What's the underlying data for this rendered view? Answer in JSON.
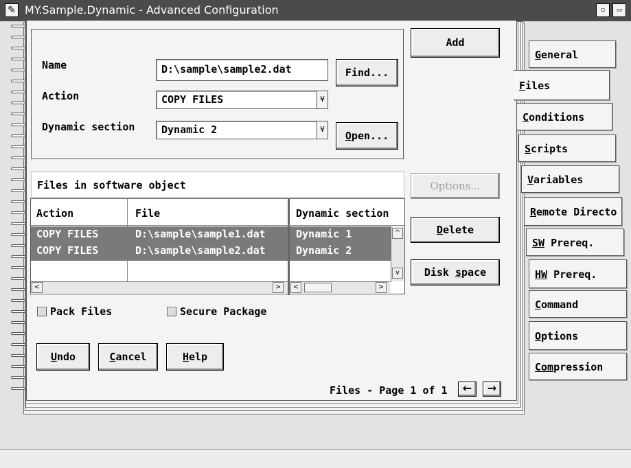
{
  "window": {
    "title": "MY.Sample.Dynamic - Advanced Configuration",
    "icon": "checkbox-pen-icon",
    "min_glyph": "▫",
    "max_glyph": "▭"
  },
  "form": {
    "name_label": "Name",
    "name_value": "D:\\sample\\sample2.dat",
    "find_button": "Find...",
    "action_label": "Action",
    "action_value": "COPY FILES",
    "dynamic_label": "Dynamic section",
    "dynamic_value": "Dynamic 2",
    "open_button_pre": "",
    "open_button_key": "O",
    "open_button_post": "pen...",
    "combo_arrow_glyph": "¥"
  },
  "buttons": {
    "add": "Add",
    "options": "Options...",
    "delete_key": "D",
    "delete_post": "elete",
    "disk_pre": "Disk ",
    "disk_key": "s",
    "disk_post": "pace",
    "undo_key": "U",
    "undo_post": "ndo",
    "cancel_key": "C",
    "cancel_post": "ancel",
    "help_key": "H",
    "help_post": "elp"
  },
  "list": {
    "title": "Files in software object",
    "columns": [
      "Action",
      "File",
      "Dynamic section"
    ],
    "rows": [
      {
        "action": "COPY FILES",
        "file": "D:\\sample\\sample1.dat",
        "section": "Dynamic 1"
      },
      {
        "action": "COPY FILES",
        "file": "D:\\sample\\sample2.dat",
        "section": "Dynamic 2"
      }
    ]
  },
  "checkboxes": {
    "pack": "Pack Files",
    "secure": "Secure Package"
  },
  "pager": {
    "text": "Files - Page 1 of 1",
    "prev_glyph": "←",
    "next_glyph": "→"
  },
  "tabs": [
    {
      "key": "G",
      "rest": "eneral"
    },
    {
      "key": "F",
      "rest": "iles"
    },
    {
      "key": "C",
      "rest": "onditions"
    },
    {
      "key": "S",
      "rest": "cripts"
    },
    {
      "key": "V",
      "rest": "ariables"
    },
    {
      "key": "R",
      "rest": "emote Directo"
    },
    {
      "key": "SW",
      "rest": " Prereq."
    },
    {
      "key": "HW",
      "rest": " Prereq."
    },
    {
      "key": "C",
      "rest": "ommand"
    },
    {
      "key": "O",
      "rest": "ptions"
    },
    {
      "key": "Com",
      "rest": "pression"
    }
  ],
  "scroll": {
    "left": "<",
    "right": ">",
    "up": "^",
    "down": "v"
  },
  "colors": {
    "titlebar": "#4b4b4b",
    "selection": "#7a7a7a",
    "background": "#e3e3e3"
  }
}
